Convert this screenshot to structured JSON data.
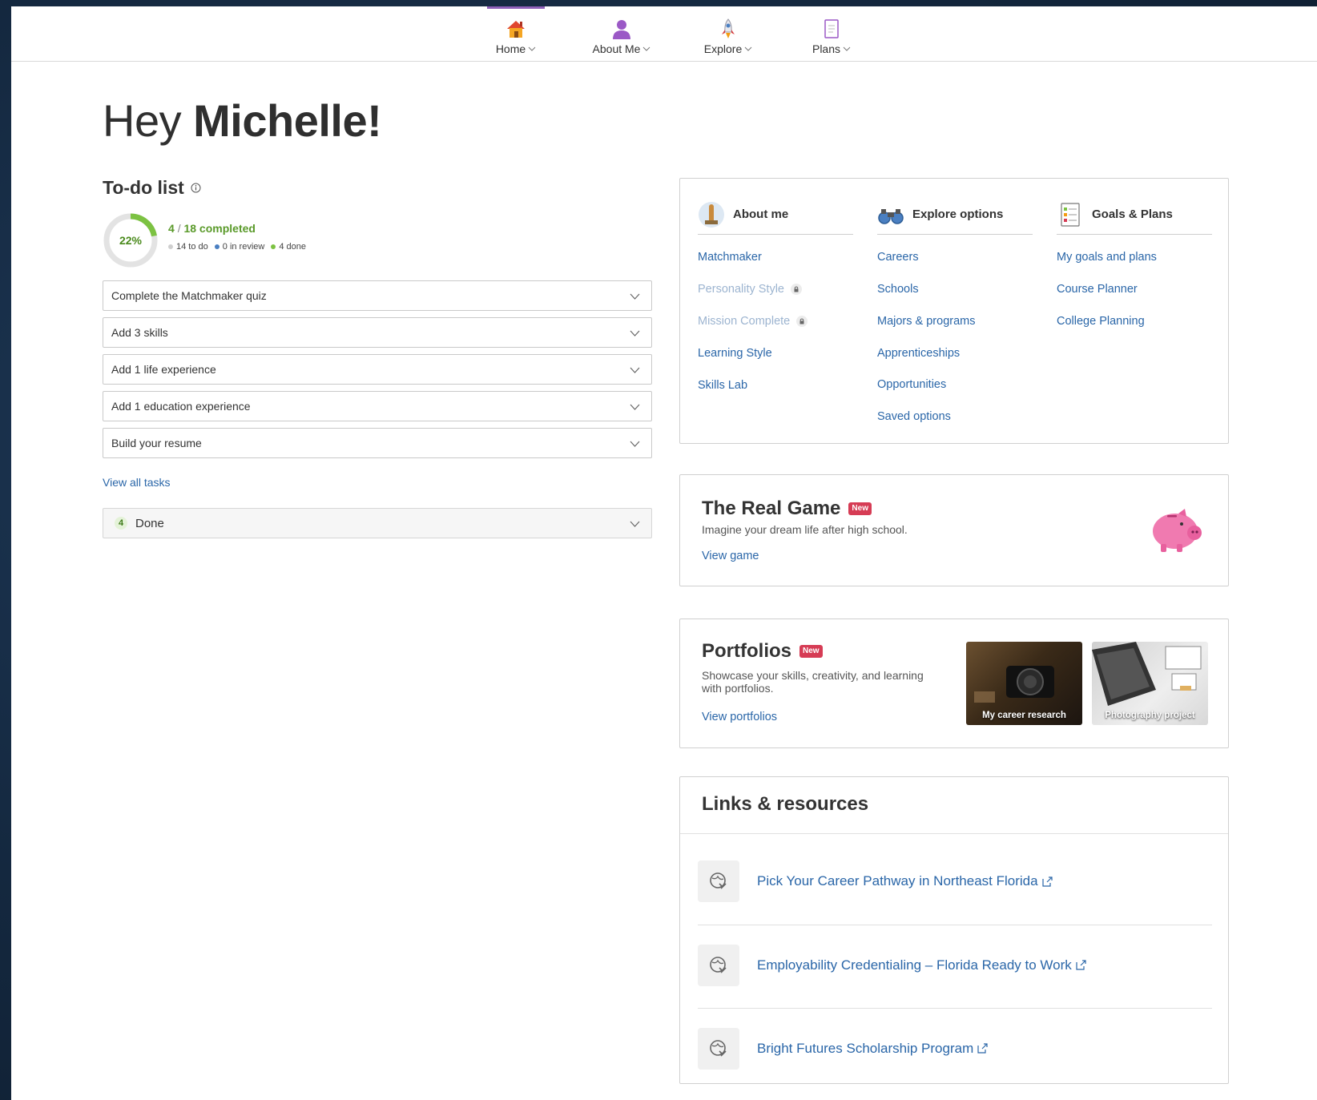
{
  "nav": [
    {
      "label": "Home",
      "icon": "house-icon",
      "active": true
    },
    {
      "label": "About Me",
      "icon": "person-icon",
      "active": false
    },
    {
      "label": "Explore",
      "icon": "rocket-icon",
      "active": false
    },
    {
      "label": "Plans",
      "icon": "clipboard-icon",
      "active": false
    }
  ],
  "greeting": {
    "prefix": "Hey",
    "name": "Michelle!"
  },
  "todo": {
    "title": "To-do list",
    "percent_label": "22%",
    "percent_value": 22,
    "done_count": "4",
    "total_label": "18 completed",
    "stats": {
      "todo": "14 to do",
      "review": "0 in review",
      "done": "4 done"
    },
    "tasks": [
      "Complete the Matchmaker quiz",
      "Add 3 skills",
      "Add 1 life experience",
      "Add 1 education experience",
      "Build your resume"
    ],
    "view_all": "View all tasks",
    "done_section": {
      "count": "4",
      "label": "Done"
    }
  },
  "quicklinks": {
    "columns": [
      {
        "heading": "About me",
        "icon": "figure-icon",
        "links": [
          {
            "label": "Matchmaker",
            "locked": false
          },
          {
            "label": "Personality Style",
            "locked": true
          },
          {
            "label": "Mission Complete",
            "locked": true
          },
          {
            "label": "Learning Style",
            "locked": false
          },
          {
            "label": "Skills Lab",
            "locked": false
          }
        ]
      },
      {
        "heading": "Explore options",
        "icon": "binoculars-icon",
        "links": [
          {
            "label": "Careers",
            "locked": false
          },
          {
            "label": "Schools",
            "locked": false
          },
          {
            "label": "Majors & programs",
            "locked": false
          },
          {
            "label": "Apprenticeships",
            "locked": false
          },
          {
            "label": "Opportunities",
            "locked": false
          },
          {
            "label": "Saved options",
            "locked": false
          }
        ]
      },
      {
        "heading": "Goals & Plans",
        "icon": "checklist-icon",
        "links": [
          {
            "label": "My goals and plans",
            "locked": false
          },
          {
            "label": "Course Planner",
            "locked": false
          },
          {
            "label": "College Planning",
            "locked": false
          }
        ]
      }
    ]
  },
  "real_game": {
    "title": "The Real Game",
    "badge": "New",
    "description": "Imagine your dream life after high school.",
    "link": "View game"
  },
  "portfolios": {
    "title": "Portfolios",
    "badge": "New",
    "description": "Showcase your skills, creativity, and learning with portfolios.",
    "link": "View portfolios",
    "thumbnails": [
      "My career research",
      "Photography project"
    ]
  },
  "resources": {
    "title": "Links & resources",
    "items": [
      "Pick Your Career Pathway in Northeast Florida",
      "Employability Credentialing – Florida Ready to Work",
      "Bright Futures Scholarship Program"
    ]
  },
  "colors": {
    "accent_purple": "#8e5fb8",
    "link_blue": "#2a66a8",
    "progress_green": "#7cc242",
    "badge_red": "#d63c55"
  }
}
